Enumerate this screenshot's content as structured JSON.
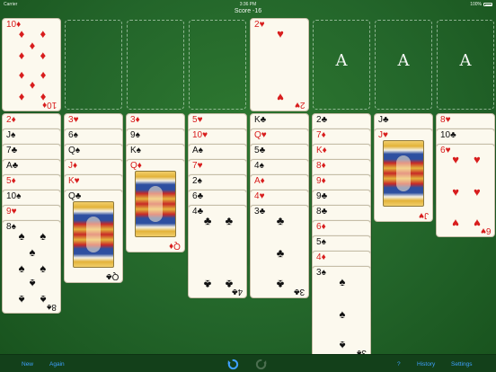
{
  "status": {
    "carrier": "Carrier",
    "time": "3:36 PM",
    "battery": "100%",
    "battery_level": 1.0
  },
  "header": {
    "score_text": "Score -16"
  },
  "free_cells": [
    {
      "card": {
        "rank": "10",
        "suit": "♦",
        "color": "red"
      }
    },
    {
      "card": null
    },
    {
      "card": null
    },
    {
      "card": null
    }
  ],
  "foundations": [
    {
      "card": {
        "rank": "2",
        "suit": "♥",
        "color": "red"
      },
      "placeholder": ""
    },
    {
      "card": null,
      "placeholder": "A"
    },
    {
      "card": null,
      "placeholder": "A"
    },
    {
      "card": null,
      "placeholder": "A"
    }
  ],
  "tableau": [
    {
      "cards": [
        {
          "rank": "2",
          "suit": "♦",
          "color": "red"
        },
        {
          "rank": "J",
          "suit": "♠",
          "color": "black"
        },
        {
          "rank": "7",
          "suit": "♣",
          "color": "black"
        },
        {
          "rank": "A",
          "suit": "♣",
          "color": "black"
        },
        {
          "rank": "5",
          "suit": "♦",
          "color": "red"
        },
        {
          "rank": "10",
          "suit": "♠",
          "color": "black"
        },
        {
          "rank": "9",
          "suit": "♥",
          "color": "red"
        },
        {
          "rank": "8",
          "suit": "♠",
          "color": "black"
        }
      ]
    },
    {
      "cards": [
        {
          "rank": "3",
          "suit": "♥",
          "color": "red"
        },
        {
          "rank": "6",
          "suit": "♠",
          "color": "black"
        },
        {
          "rank": "Q",
          "suit": "♠",
          "color": "black"
        },
        {
          "rank": "J",
          "suit": "♦",
          "color": "red"
        },
        {
          "rank": "K",
          "suit": "♥",
          "color": "red"
        },
        {
          "rank": "Q",
          "suit": "♣",
          "color": "black"
        }
      ]
    },
    {
      "cards": [
        {
          "rank": "3",
          "suit": "♦",
          "color": "red"
        },
        {
          "rank": "9",
          "suit": "♠",
          "color": "black"
        },
        {
          "rank": "K",
          "suit": "♠",
          "color": "black"
        },
        {
          "rank": "Q",
          "suit": "♦",
          "color": "red"
        }
      ]
    },
    {
      "cards": [
        {
          "rank": "5",
          "suit": "♥",
          "color": "red"
        },
        {
          "rank": "10",
          "suit": "♥",
          "color": "red"
        },
        {
          "rank": "A",
          "suit": "♠",
          "color": "black"
        },
        {
          "rank": "7",
          "suit": "♥",
          "color": "red"
        },
        {
          "rank": "2",
          "suit": "♠",
          "color": "black"
        },
        {
          "rank": "6",
          "suit": "♣",
          "color": "black"
        },
        {
          "rank": "4",
          "suit": "♣",
          "color": "black"
        }
      ]
    },
    {
      "cards": [
        {
          "rank": "K",
          "suit": "♣",
          "color": "black"
        },
        {
          "rank": "Q",
          "suit": "♥",
          "color": "red"
        },
        {
          "rank": "5",
          "suit": "♣",
          "color": "black"
        },
        {
          "rank": "4",
          "suit": "♠",
          "color": "black"
        },
        {
          "rank": "A",
          "suit": "♦",
          "color": "red"
        },
        {
          "rank": "4",
          "suit": "♥",
          "color": "red"
        },
        {
          "rank": "3",
          "suit": "♣",
          "color": "black"
        }
      ]
    },
    {
      "cards": [
        {
          "rank": "2",
          "suit": "♣",
          "color": "black"
        },
        {
          "rank": "7",
          "suit": "♦",
          "color": "red"
        },
        {
          "rank": "K",
          "suit": "♦",
          "color": "red"
        },
        {
          "rank": "8",
          "suit": "♦",
          "color": "red"
        },
        {
          "rank": "9",
          "suit": "♦",
          "color": "red"
        },
        {
          "rank": "9",
          "suit": "♣",
          "color": "black"
        },
        {
          "rank": "8",
          "suit": "♣",
          "color": "black"
        },
        {
          "rank": "6",
          "suit": "♦",
          "color": "red"
        },
        {
          "rank": "5",
          "suit": "♠",
          "color": "black"
        },
        {
          "rank": "4",
          "suit": "♦",
          "color": "red"
        },
        {
          "rank": "3",
          "suit": "♠",
          "color": "black"
        }
      ]
    },
    {
      "cards": [
        {
          "rank": "J",
          "suit": "♣",
          "color": "black"
        },
        {
          "rank": "J",
          "suit": "♥",
          "color": "red"
        }
      ]
    },
    {
      "cards": [
        {
          "rank": "8",
          "suit": "♥",
          "color": "red"
        },
        {
          "rank": "10",
          "suit": "♣",
          "color": "black"
        },
        {
          "rank": "6",
          "suit": "♥",
          "color": "red"
        }
      ]
    }
  ],
  "toolbar": {
    "new_label": "New",
    "again_label": "Again",
    "hint_label": "?",
    "history_label": "History",
    "settings_label": "Settings",
    "undo_icon": "undo-icon",
    "redo_icon": "redo-icon"
  },
  "colors": {
    "felt": "#23652a",
    "card_face": "#fcf9ee",
    "red_suit": "#d81d1d",
    "black_suit": "#111111",
    "toolbar_accent": "#3fa0ff"
  }
}
